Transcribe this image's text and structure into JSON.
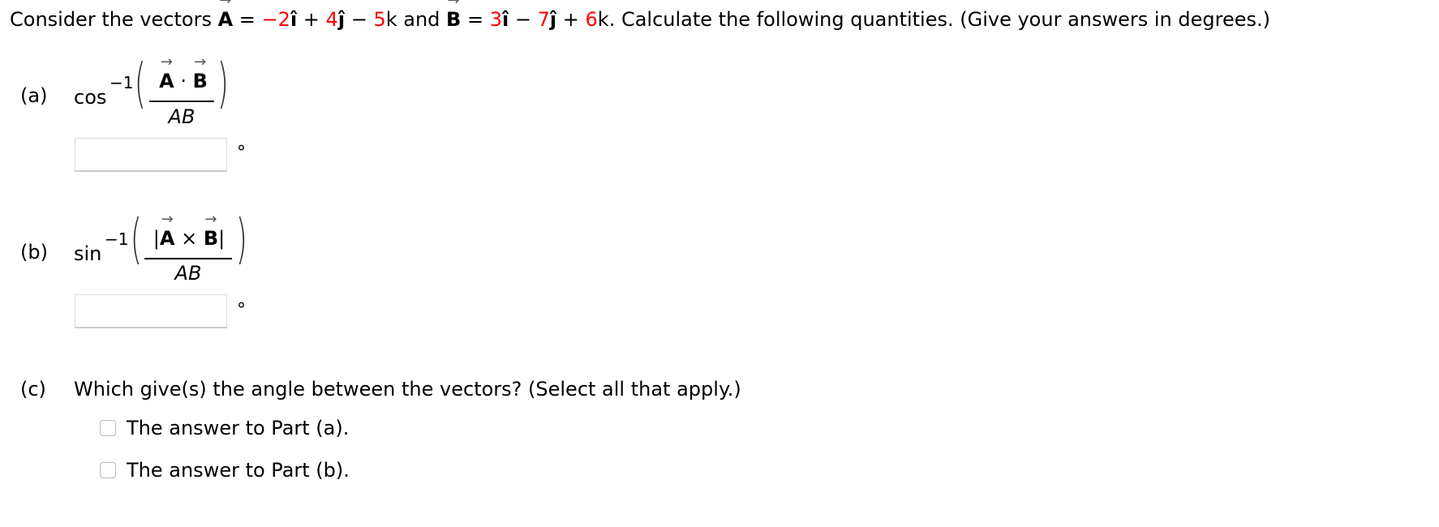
{
  "intro": {
    "prefix": "Consider the vectors ",
    "vecA": "A",
    "eq1": " = ",
    "a_i": "−2",
    "i_hat": "î",
    "plus1": " + ",
    "a_j": "4",
    "j_hat": "ĵ",
    "minus1": " − ",
    "a_k": "5",
    "k": "k",
    "and": " and ",
    "vecB": "B",
    "eq2": " = ",
    "b_i": "3",
    "minus2": " − ",
    "b_j": "7",
    "plus2": " + ",
    "b_k": "6",
    "suffix": ". Calculate the following quantities. (Give your answers in degrees.)"
  },
  "symbols": {
    "arrow": "→",
    "hat": "^",
    "degree": "°",
    "neg_one": "−1",
    "left_paren": "(",
    "right_paren": ")"
  },
  "parts": {
    "a": {
      "label": "(a)",
      "function": "cos",
      "numerator_A": "A",
      "numerator_op": " · ",
      "numerator_B": "B",
      "denominator": "AB",
      "answer_value": ""
    },
    "b": {
      "label": "(b)",
      "function": "sin",
      "numerator_open": "|",
      "numerator_A": "A",
      "numerator_op": " × ",
      "numerator_B": "B",
      "numerator_close": "|",
      "denominator": "AB",
      "answer_value": ""
    },
    "c": {
      "label": "(c)",
      "question": "Which give(s) the angle between the vectors? (Select all that apply.)",
      "options": [
        {
          "label": "The answer to Part (a).",
          "checked": false
        },
        {
          "label": "The answer to Part (b).",
          "checked": false
        }
      ]
    }
  }
}
